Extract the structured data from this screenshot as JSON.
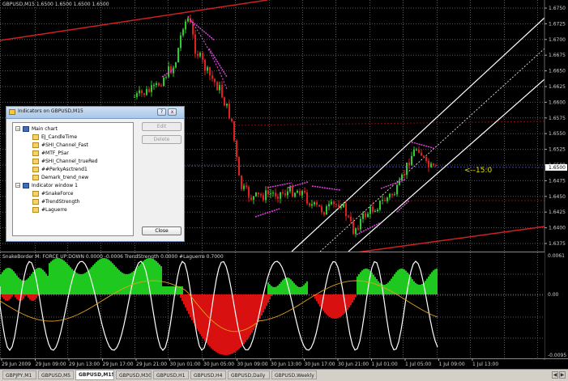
{
  "chart": {
    "main_title": "GBPUSD,M15  1.6500 1.6500 1.6500 1.6500",
    "price_labels": [
      "1.6750",
      "1.6725",
      "1.6700",
      "1.6675",
      "1.6650",
      "1.6625",
      "1.6600",
      "1.6575",
      "1.6550",
      "1.6525",
      "1.6500",
      "1.6475",
      "1.6450",
      "1.6425",
      "1.6400",
      "1.6375"
    ],
    "current_price": "1.6500",
    "annotation": "<--15:0",
    "sub_title": "SnakeBorder M: FORCE UP   DOWN  0.0000  -0.0006   TrendStrength 0.0000  #Laguerre 0.7000",
    "sub_labels": [
      "0.0061",
      "0.00",
      "-0.0095"
    ],
    "time_labels": [
      "29 Jun 2009",
      "29 Jun 09:00",
      "29 Jun 13:00",
      "29 Jun 17:00",
      "29 Jun 21:00",
      "30 Jun 01:00",
      "30 Jun 05:00",
      "30 Jun 09:00",
      "30 Jun 13:00",
      "30 Jun 17:00",
      "30 Jun 21:00",
      "1 Jul 01:00",
      "1 Jul 05:00",
      "1 Jul 09:00",
      "1 Jul 13:00"
    ],
    "colors": {
      "bull": "#2ecc2e",
      "bear": "#e02020",
      "channel": "#ffffff",
      "magenta": "#e040e0",
      "red_line": "#d02020",
      "annotation": "#e0e000"
    }
  },
  "tabs": [
    "GBPJPY,M1",
    "GBPUSD,M5",
    "GBPUSD,M15",
    "GBPUSD,M30",
    "GBPUSD,H1",
    "GBPUSD,H4",
    "GBPUSD,Daily",
    "GBPUSD,Weekly"
  ],
  "active_tab": "GBPUSD,M15",
  "dialog": {
    "title": "Indicators on GBPUSD,M15",
    "help_label": "?",
    "close_x": "x",
    "groups": [
      {
        "label": "Main chart",
        "items": [
          "EJ_CandleTime",
          "#SHI_Channel_Fast",
          "#MTF_PSar",
          "#SHI_Channel_trueRed",
          "##PerkyAsctrend1",
          "Demark_trend_new"
        ]
      },
      {
        "label": "Indicator window 1",
        "items": [
          "#SnakeForce",
          "#TrendStrength",
          "#Laguerre"
        ]
      }
    ],
    "edit_label": "Edit",
    "delete_label": "Delete",
    "close_label": "Close"
  }
}
